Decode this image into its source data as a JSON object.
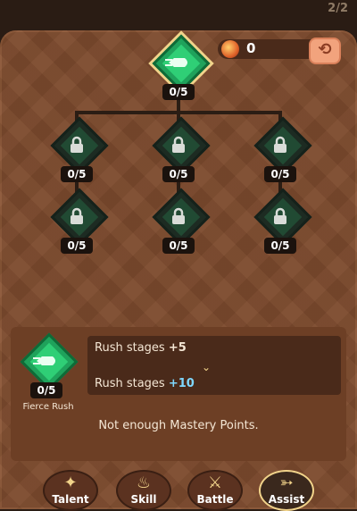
{
  "header": {
    "page_indicator": "2/2"
  },
  "mastery": {
    "icon": "potion-icon",
    "points": "0",
    "reset_icon": "reset-icon"
  },
  "nodes": [
    {
      "id": "root",
      "count": "0/5",
      "icon": "fish-dash-icon",
      "locked": false
    },
    {
      "id": "r1c1",
      "count": "0/5",
      "icon": "lock-icon",
      "locked": true
    },
    {
      "id": "r1c2",
      "count": "0/5",
      "icon": "lock-icon",
      "locked": true
    },
    {
      "id": "r1c3",
      "count": "0/5",
      "icon": "lock-icon",
      "locked": true
    },
    {
      "id": "r2c1",
      "count": "0/5",
      "icon": "lock-icon",
      "locked": true
    },
    {
      "id": "r2c2",
      "count": "0/5",
      "icon": "lock-icon",
      "locked": true
    },
    {
      "id": "r2c3",
      "count": "0/5",
      "icon": "lock-icon",
      "locked": true
    }
  ],
  "detail": {
    "count": "0/5",
    "name": "Fierce Rush",
    "current_label": "Rush stages ",
    "current_value": "+5",
    "next_label": "Rush stages ",
    "next_value": "+10",
    "message": "Not enough Mastery Points."
  },
  "tabs": [
    {
      "label": "Talent",
      "icon": "hands-icon",
      "selected": false
    },
    {
      "label": "Skill",
      "icon": "flame-icon",
      "selected": false
    },
    {
      "label": "Battle",
      "icon": "crossed-swords-icon",
      "selected": false
    },
    {
      "label": "Assist",
      "icon": "arrow-icon",
      "selected": true
    }
  ],
  "colors": {
    "accent": "#f1d38a",
    "active_node": "#2fcf76",
    "panel": "#7d4b2e"
  }
}
